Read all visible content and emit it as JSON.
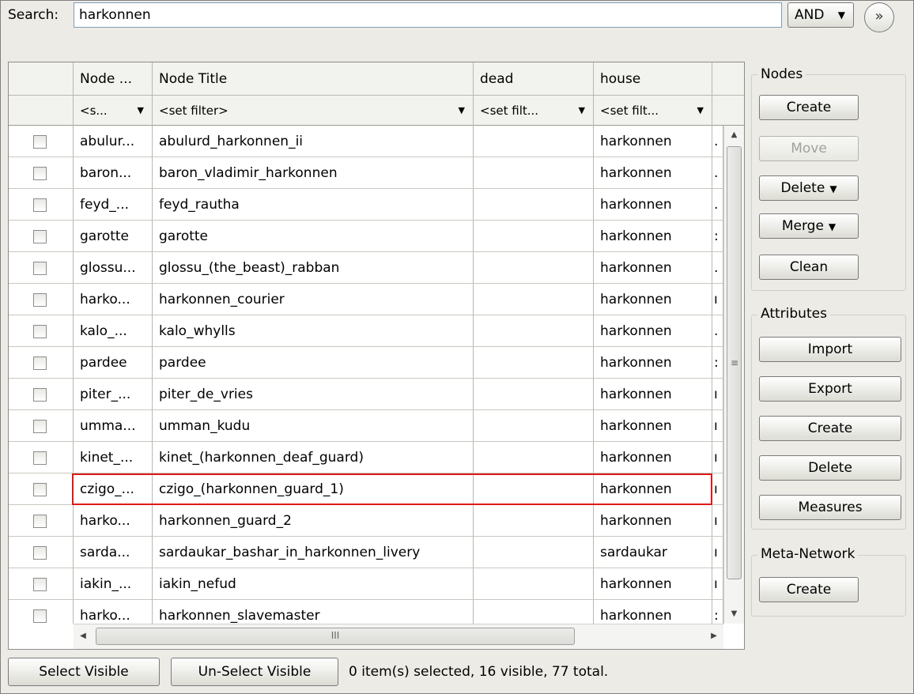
{
  "search": {
    "label": "Search:",
    "value": "harkonnen",
    "operator": "AND"
  },
  "table": {
    "columns": [
      "Node ...",
      "Node Title",
      "dead",
      "house"
    ],
    "filters": [
      "<s...",
      "<set filter>",
      "<set filt...",
      "<set filt..."
    ],
    "rows": [
      {
        "id": "abulur...",
        "title": "abulurd_harkonnen_ii",
        "dead": "",
        "house": "harkonnen",
        "extra": "."
      },
      {
        "id": "baron...",
        "title": "baron_vladimir_harkonnen",
        "dead": "",
        "house": "harkonnen",
        "extra": "."
      },
      {
        "id": "feyd_...",
        "title": "feyd_rautha",
        "dead": "",
        "house": "harkonnen",
        "extra": "."
      },
      {
        "id": "garotte",
        "title": "garotte",
        "dead": "",
        "house": "harkonnen",
        "extra": ":"
      },
      {
        "id": "glossu...",
        "title": "glossu_(the_beast)_rabban",
        "dead": "",
        "house": "harkonnen",
        "extra": "."
      },
      {
        "id": "harko...",
        "title": "harkonnen_courier",
        "dead": "",
        "house": "harkonnen",
        "extra": "ı"
      },
      {
        "id": "kalo_...",
        "title": "kalo_whylls",
        "dead": "",
        "house": "harkonnen",
        "extra": "."
      },
      {
        "id": "pardee",
        "title": "pardee",
        "dead": "",
        "house": "harkonnen",
        "extra": ":"
      },
      {
        "id": "piter_...",
        "title": "piter_de_vries",
        "dead": "",
        "house": "harkonnen",
        "extra": "ı"
      },
      {
        "id": "umma...",
        "title": "umman_kudu",
        "dead": "",
        "house": "harkonnen",
        "extra": "ı"
      },
      {
        "id": "kinet_...",
        "title": "kinet_(harkonnen_deaf_guard)",
        "dead": "",
        "house": "harkonnen",
        "extra": "ı"
      },
      {
        "id": "czigo_...",
        "title": "czigo_(harkonnen_guard_1)",
        "dead": "",
        "house": "harkonnen",
        "extra": "ı"
      },
      {
        "id": "harko...",
        "title": "harkonnen_guard_2",
        "dead": "",
        "house": "harkonnen",
        "extra": "ı"
      },
      {
        "id": "sarda...",
        "title": "sardaukar_bashar_in_harkonnen_livery",
        "dead": "",
        "house": "sardaukar",
        "extra": "ı"
      },
      {
        "id": "iakin_...",
        "title": "iakin_nefud",
        "dead": "",
        "house": "harkonnen",
        "extra": "ı"
      },
      {
        "id": "harko...",
        "title": "harkonnen_slavemaster",
        "dead": "",
        "house": "harkonnen",
        "extra": ":"
      }
    ]
  },
  "bottom": {
    "select_visible": "Select Visible",
    "unselect_visible": "Un-Select Visible",
    "status": "0 item(s) selected, 16 visible, 77 total."
  },
  "side": {
    "nodes": {
      "title": "Nodes",
      "create": "Create",
      "move": "Move",
      "delete": "Delete",
      "merge": "Merge",
      "clean": "Clean"
    },
    "attributes": {
      "title": "Attributes",
      "import": "Import",
      "export": "Export",
      "create": "Create",
      "delete": "Delete",
      "measures": "Measures"
    },
    "meta": {
      "title": "Meta-Network",
      "create": "Create"
    }
  },
  "colors": {
    "highlight": "#e01818",
    "panel_bg": "#ecebe6"
  }
}
